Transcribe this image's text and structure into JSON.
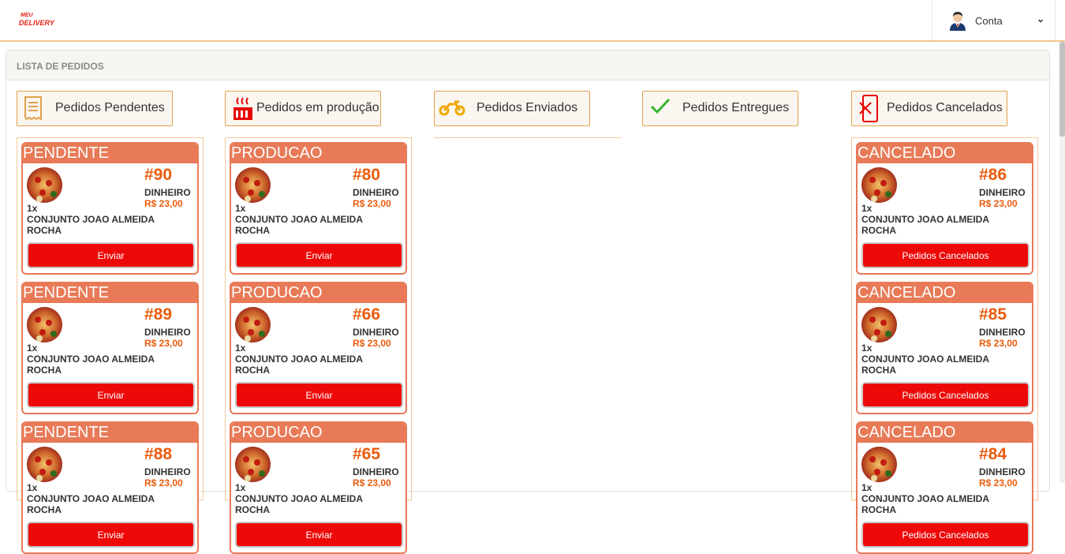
{
  "brand": {
    "line1": "MEU",
    "line2": "DELIVERY"
  },
  "account": {
    "label": "Conta",
    "avatar_icon": "user-avatar-icon",
    "chevron_icon": "chevron-down-icon"
  },
  "panel": {
    "title": "LISTA DE PEDIDOS"
  },
  "colors": {
    "accent": "#e0a24f",
    "card_header": "#e87a57",
    "order_number": "#ea5b0c",
    "action_button": "#ee0909"
  },
  "columns": [
    {
      "label": "Pedidos Pendentes",
      "icon": "receipt-icon",
      "orders": [
        {
          "status": "PENDENTE",
          "number": "#90",
          "payment": "DINHEIRO",
          "price": "R$ 23,00",
          "qty": "1x",
          "item": "CONJUNTO JOAO ALMEIDA ROCHA",
          "action": "Enviar"
        },
        {
          "status": "PENDENTE",
          "number": "#89",
          "payment": "DINHEIRO",
          "price": "R$ 23,00",
          "qty": "1x",
          "item": "CONJUNTO JOAO ALMEIDA ROCHA",
          "action": "Enviar"
        },
        {
          "status": "PENDENTE",
          "number": "#88",
          "payment": "DINHEIRO",
          "price": "R$ 23,00",
          "qty": "1x",
          "item": "CONJUNTO JOAO ALMEIDA ROCHA",
          "action": "Enviar"
        }
      ]
    },
    {
      "label": "Pedidos em produção",
      "icon": "oven-icon",
      "orders": [
        {
          "status": "PRODUCAO",
          "number": "#80",
          "payment": "DINHEIRO",
          "price": "R$ 23,00",
          "qty": "1x",
          "item": "CONJUNTO JOAO ALMEIDA ROCHA",
          "action": "Enviar"
        },
        {
          "status": "PRODUCAO",
          "number": "#66",
          "payment": "DINHEIRO",
          "price": "R$ 23,00",
          "qty": "1x",
          "item": "CONJUNTO JOAO ALMEIDA ROCHA",
          "action": "Enviar"
        },
        {
          "status": "PRODUCAO",
          "number": "#65",
          "payment": "DINHEIRO",
          "price": "R$ 23,00",
          "qty": "1x",
          "item": "CONJUNTO JOAO ALMEIDA ROCHA",
          "action": "Enviar"
        }
      ]
    },
    {
      "label": "Pedidos Enviados",
      "icon": "motorcycle-icon",
      "orders": []
    },
    {
      "label": "Pedidos Entregues",
      "icon": "checkmark-icon",
      "orders": []
    },
    {
      "label": "Pedidos Cancelados",
      "icon": "cancel-phone-icon",
      "orders": [
        {
          "status": "CANCELADO",
          "number": "#86",
          "payment": "DINHEIRO",
          "price": "R$ 23,00",
          "qty": "1x",
          "item": "CONJUNTO JOAO ALMEIDA ROCHA",
          "action": "Pedidos Cancelados"
        },
        {
          "status": "CANCELADO",
          "number": "#85",
          "payment": "DINHEIRO",
          "price": "R$ 23,00",
          "qty": "1x",
          "item": "CONJUNTO JOAO ALMEIDA ROCHA",
          "action": "Pedidos Cancelados"
        },
        {
          "status": "CANCELADO",
          "number": "#84",
          "payment": "DINHEIRO",
          "price": "R$ 23,00",
          "qty": "1x",
          "item": "CONJUNTO JOAO ALMEIDA ROCHA",
          "action": "Pedidos Cancelados"
        }
      ]
    }
  ]
}
